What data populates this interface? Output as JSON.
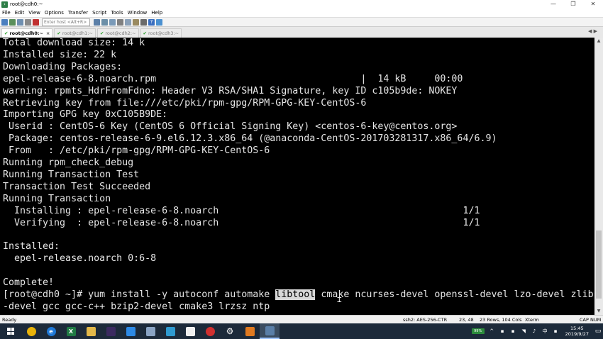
{
  "window": {
    "title": "root@cdh0:~",
    "controls": [
      "—",
      "❐",
      "✕"
    ]
  },
  "menu": [
    "File",
    "Edit",
    "View",
    "Options",
    "Transfer",
    "Script",
    "Tools",
    "Window",
    "Help"
  ],
  "toolbar": {
    "host_placeholder": "Enter host <Alt+R>"
  },
  "tabs": [
    {
      "label": "root@cdh0:~",
      "active": true
    },
    {
      "label": "root@cdh1:~",
      "active": false
    },
    {
      "label": "root@cdh2:~",
      "active": false
    },
    {
      "label": "root@cdh3:~",
      "active": false
    }
  ],
  "tab_nav": "◀ ▶",
  "terminal": {
    "lines": [
      "Total download size: 14 k",
      "Installed size: 22 k",
      "Downloading Packages:",
      "epel-release-6-8.noarch.rpm                                    |  14 kB     00:00",
      "warning: rpmts_HdrFromFdno: Header V3 RSA/SHA1 Signature, key ID c105b9de: NOKEY",
      "Retrieving key from file:///etc/pki/rpm-gpg/RPM-GPG-KEY-CentOS-6",
      "Importing GPG key 0xC105B9DE:",
      " Userid : CentOS-6 Key (CentOS 6 Official Signing Key) <centos-6-key@centos.org>",
      " Package: centos-release-6-9.el6.12.3.x86_64 (@anaconda-CentOS-201703281317.x86_64/6.9)",
      " From   : /etc/pki/rpm-gpg/RPM-GPG-KEY-CentOS-6",
      "Running rpm_check_debug",
      "Running Transaction Test",
      "Transaction Test Succeeded",
      "Running Transaction",
      "  Installing : epel-release-6-8.noarch                                           1/1",
      "  Verifying  : epel-release-6-8.noarch                                           1/1",
      "",
      "Installed:",
      "  epel-release.noarch 0:6-8",
      "",
      "Complete!"
    ],
    "cmd_prefix": "[root@cdh0 ~]# yum install -y autoconf automake ",
    "cmd_highlight": "libtool",
    "cmd_suffix": " cmake ncurses-devel openssl-devel lzo-devel zlib",
    "cmd_line2": "-devel gcc gcc-c++ bzip2-devel cmake3 lrzsz ntp"
  },
  "status": {
    "ready": "Ready",
    "cipher": "ssh2: AES-256-CTR",
    "position": "23, 48",
    "size": "23 Rows, 104 Cols",
    "term": "Xterm",
    "caps": "CAP NUM"
  },
  "taskbar": {
    "battery": "99%",
    "time": "15:45",
    "date": "2019/9/27"
  },
  "colors": {
    "terminal_bg": "#000000",
    "terminal_fg": "#e6e6e6",
    "taskbar_bg": "#1c2a3a"
  }
}
